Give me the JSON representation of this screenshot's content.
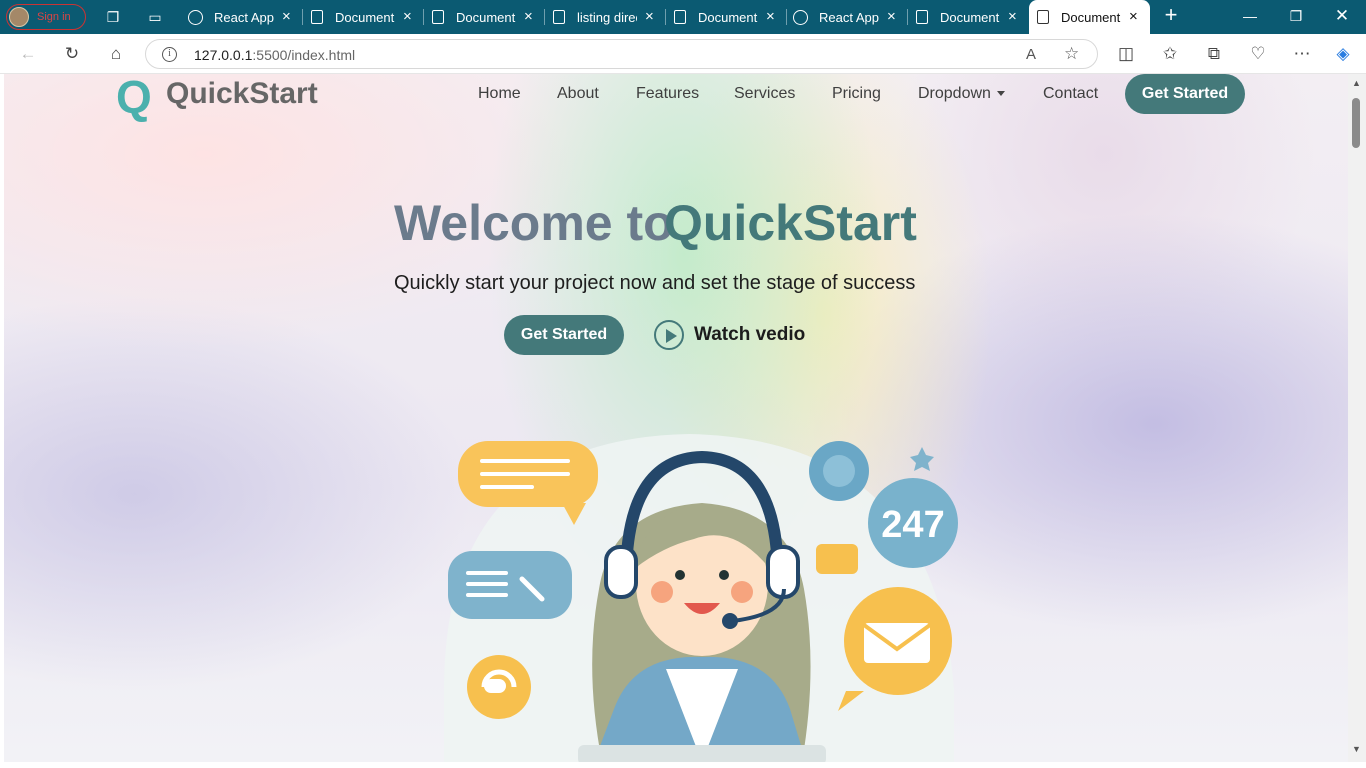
{
  "browser": {
    "profile_label": "Sign in",
    "tabs": [
      {
        "title": "React App",
        "kind": "react"
      },
      {
        "title": "Document",
        "kind": "doc"
      },
      {
        "title": "Document",
        "kind": "doc"
      },
      {
        "title": "listing direc",
        "kind": "doc"
      },
      {
        "title": "Document",
        "kind": "doc"
      },
      {
        "title": "React App",
        "kind": "react"
      },
      {
        "title": "Document",
        "kind": "doc"
      },
      {
        "title": "Document",
        "kind": "doc",
        "active": true
      }
    ],
    "url_host": "127.0.0.1",
    "url_rest": ":5500/index.html"
  },
  "site": {
    "logo_letter": "Q",
    "logo_text": "QuickStart",
    "nav": [
      "Home",
      "About",
      "Features",
      "Services",
      "Pricing",
      "Dropdown",
      "Contact"
    ],
    "nav_cta": "Get Started",
    "hero": {
      "title_part1": "Welcome to",
      "title_part2": "QuickStart",
      "subtitle": "Quickly start your project now and set the stage of success",
      "cta": "Get Started",
      "watch_label": "Watch vedio"
    },
    "illustration_badge": "247"
  },
  "colors": {
    "accent": "#44797a",
    "logo": "#4bb0ad",
    "title_grey": "#6b7b8c",
    "tabbar": "#0b5a72"
  }
}
